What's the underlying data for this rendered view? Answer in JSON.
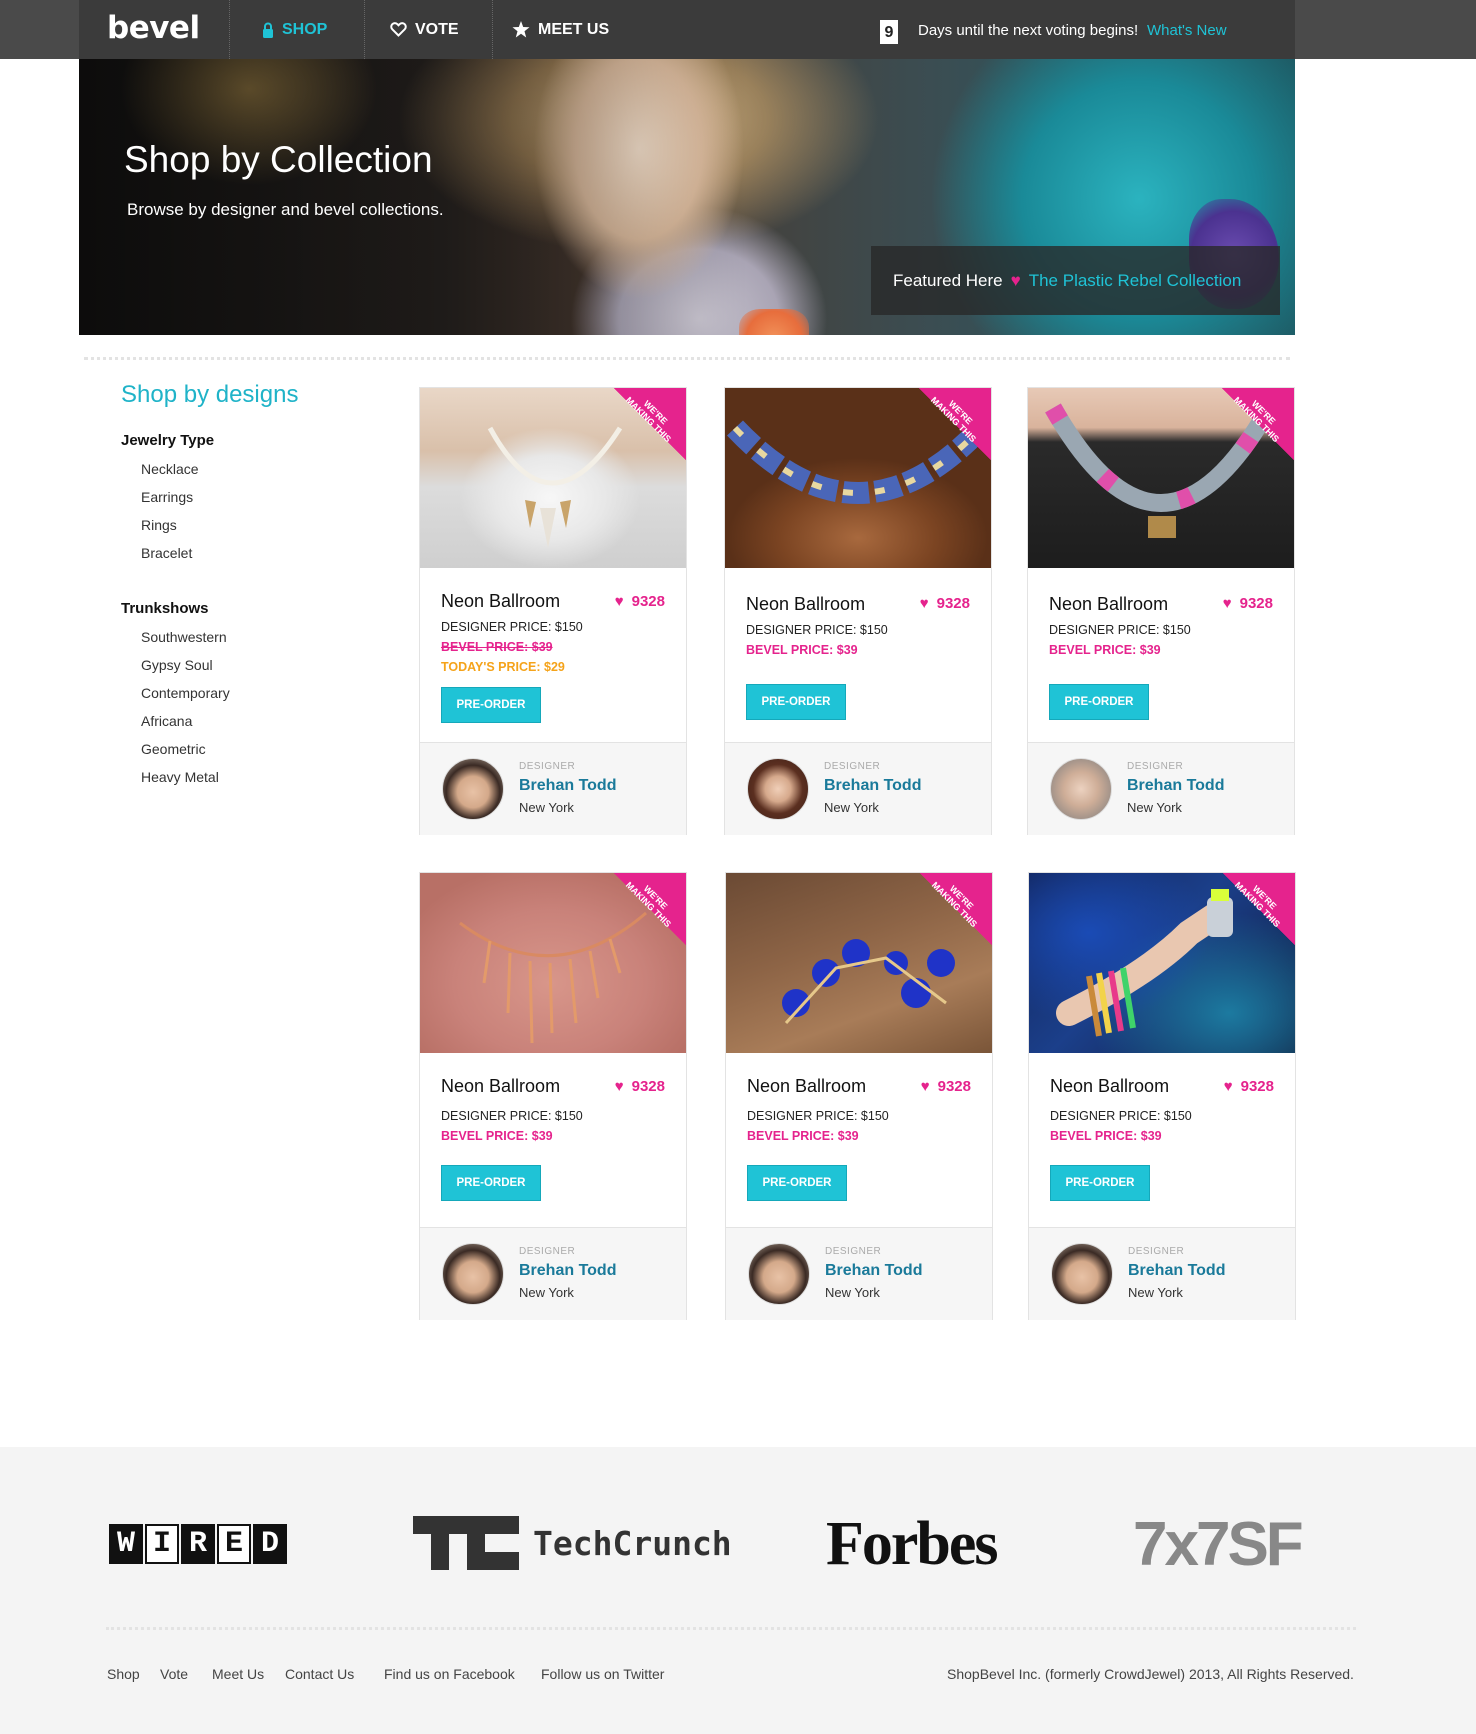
{
  "header": {
    "logo": "bevel",
    "nav": [
      {
        "label": "SHOP",
        "icon": "lock-icon",
        "active": true
      },
      {
        "label": "VOTE",
        "icon": "heart-outline-icon",
        "active": false
      },
      {
        "label": "MEET US",
        "icon": "star-icon",
        "active": false
      }
    ],
    "days_count": "9",
    "days_text": "Days until the next voting begins!",
    "whats_new": "What's New"
  },
  "hero": {
    "title": "Shop by Collection",
    "subtitle": "Browse by designer and bevel collections.",
    "featured_label": "Featured Here",
    "featured_link": "The Plastic Rebel Collection"
  },
  "sidebar": {
    "title": "Shop by designs",
    "sections": [
      {
        "heading": "Jewelry Type",
        "items": [
          "Necklace",
          "Earrings",
          "Rings",
          "Bracelet"
        ]
      },
      {
        "heading": "Trunkshows",
        "items": [
          "Southwestern",
          "Gypsy Soul",
          "Contemporary",
          "Africana",
          "Geometric",
          "Heavy Metal"
        ]
      }
    ]
  },
  "products": [
    {
      "name": "Neon Ballroom",
      "likes": "9328",
      "designer_price": "DESIGNER PRICE: $150",
      "bevel_price": "BEVEL PRICE: $39",
      "bevel_struck": true,
      "todays_price": "TODAY'S PRICE: $29",
      "button": "PRE-ORDER",
      "ribbon": "WE'RE MAKING THIS",
      "designer_label": "DESIGNER",
      "designer_name": "Brehan Todd",
      "designer_city": "New York"
    },
    {
      "name": "Neon Ballroom",
      "likes": "9328",
      "designer_price": "DESIGNER PRICE: $150",
      "bevel_price": "BEVEL PRICE: $39",
      "bevel_struck": false,
      "todays_price": "",
      "button": "PRE-ORDER",
      "ribbon": "WE'RE MAKING THIS",
      "designer_label": "DESIGNER",
      "designer_name": "Brehan Todd",
      "designer_city": "New York"
    },
    {
      "name": "Neon Ballroom",
      "likes": "9328",
      "designer_price": "DESIGNER PRICE: $150",
      "bevel_price": "BEVEL PRICE: $39",
      "bevel_struck": false,
      "todays_price": "",
      "button": "PRE-ORDER",
      "ribbon": "WE'RE MAKING THIS",
      "designer_label": "DESIGNER",
      "designer_name": "Brehan Todd",
      "designer_city": "New York"
    },
    {
      "name": "Neon Ballroom",
      "likes": "9328",
      "designer_price": "DESIGNER PRICE: $150",
      "bevel_price": "BEVEL PRICE: $39",
      "bevel_struck": false,
      "todays_price": "",
      "button": "PRE-ORDER",
      "ribbon": "WE'RE MAKING THIS",
      "designer_label": "DESIGNER",
      "designer_name": "Brehan Todd",
      "designer_city": "New York"
    },
    {
      "name": "Neon Ballroom",
      "likes": "9328",
      "designer_price": "DESIGNER PRICE: $150",
      "bevel_price": "BEVEL PRICE: $39",
      "bevel_struck": false,
      "todays_price": "",
      "button": "PRE-ORDER",
      "ribbon": "WE'RE MAKING THIS",
      "designer_label": "DESIGNER",
      "designer_name": "Brehan Todd",
      "designer_city": "New York"
    },
    {
      "name": "Neon Ballroom",
      "likes": "9328",
      "designer_price": "DESIGNER PRICE: $150",
      "bevel_price": "BEVEL PRICE: $39",
      "bevel_struck": false,
      "todays_price": "",
      "button": "PRE-ORDER",
      "ribbon": "WE'RE MAKING THIS",
      "designer_label": "DESIGNER",
      "designer_name": "Brehan Todd",
      "designer_city": "New York"
    }
  ],
  "press": {
    "wired": [
      "W",
      "I",
      "R",
      "E",
      "D"
    ],
    "techcrunch": "TechCrunch",
    "forbes": "Forbes",
    "sevenbyseven": "7x7SF"
  },
  "footer": {
    "links": [
      "Shop",
      "Vote",
      "Meet Us",
      "Contact Us",
      "Find us on Facebook",
      "Follow us on Twitter"
    ],
    "copyright": "ShopBevel Inc. (formerly CrowdJewel) 2013, All Rights Reserved."
  },
  "colors": {
    "accent": "#1fc3d6",
    "pink": "#e5238d",
    "orange": "#f5a31a",
    "designer_link": "#1a7a9a"
  }
}
